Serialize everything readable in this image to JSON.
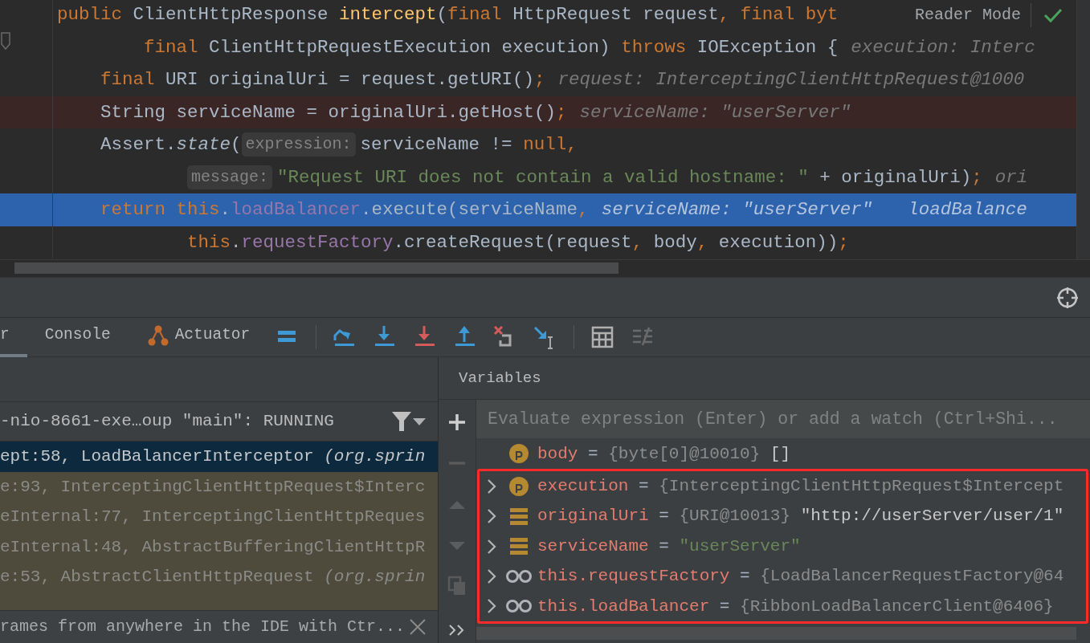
{
  "editor": {
    "reader_mode": "Reader Mode",
    "lines": [
      {
        "breakpoint": false,
        "current": false,
        "fold_marker": false,
        "segments": [
          {
            "kind": "code",
            "tokens": [
              {
                "kind": "kw",
                "text": "public "
              },
              {
                "kind": "plain",
                "text": "ClientHttpResponse "
              },
              {
                "kind": "method",
                "text": "intercept"
              },
              {
                "kind": "plain",
                "text": "("
              },
              {
                "kind": "kw",
                "text": "final "
              },
              {
                "kind": "plain",
                "text": "HttpRequest request"
              },
              {
                "kind": "kw",
                "text": ", final byt"
              }
            ]
          }
        ]
      },
      {
        "breakpoint": false,
        "current": false,
        "fold_marker": true,
        "segments": [
          {
            "kind": "code",
            "tokens": [
              {
                "kind": "kw",
                "text": "final "
              },
              {
                "kind": "plain",
                "text": "ClientHttpRequestExecution execution) "
              },
              {
                "kind": "kw",
                "text": "throws "
              },
              {
                "kind": "plain",
                "text": "IOException {"
              }
            ]
          },
          {
            "kind": "hint",
            "text": "execution: Interc"
          }
        ]
      },
      {
        "breakpoint": false,
        "current": false,
        "fold_marker": false,
        "segments": [
          {
            "kind": "code",
            "tokens": [
              {
                "kind": "kw",
                "text": "final "
              },
              {
                "kind": "plain",
                "text": "URI originalUri = request.getURI()"
              },
              {
                "kind": "kw",
                "text": ";"
              }
            ]
          },
          {
            "kind": "hint",
            "text": "request: InterceptingClientHttpRequest@1000"
          }
        ]
      },
      {
        "breakpoint": true,
        "current": false,
        "fold_marker": false,
        "segments": [
          {
            "kind": "code",
            "tokens": [
              {
                "kind": "plain",
                "text": "String serviceName = originalUri.getHost()"
              },
              {
                "kind": "kw",
                "text": ";"
              }
            ]
          },
          {
            "kind": "hint",
            "text": "serviceName: \"userServer\""
          }
        ]
      },
      {
        "breakpoint": false,
        "current": false,
        "fold_marker": false,
        "segments": [
          {
            "kind": "code",
            "tokens": [
              {
                "kind": "plain",
                "text": "Assert."
              },
              {
                "kind": "italic",
                "text": "state"
              },
              {
                "kind": "plain",
                "text": "("
              }
            ]
          },
          {
            "kind": "inlay",
            "text": "expression:"
          },
          {
            "kind": "code",
            "tokens": [
              {
                "kind": "plain",
                "text": "serviceName != "
              },
              {
                "kind": "kw",
                "text": "null,"
              }
            ]
          }
        ]
      },
      {
        "breakpoint": false,
        "current": false,
        "fold_marker": false,
        "segments": [
          {
            "kind": "inlay",
            "text": "message:"
          },
          {
            "kind": "code",
            "tokens": [
              {
                "kind": "str",
                "text": "\"Request URI does not contain a valid hostname: \""
              },
              {
                "kind": "plain",
                "text": " + originalUri)"
              },
              {
                "kind": "kw",
                "text": ";"
              }
            ]
          },
          {
            "kind": "hint",
            "text": "ori"
          }
        ]
      },
      {
        "breakpoint": false,
        "current": true,
        "fold_marker": false,
        "segments": [
          {
            "kind": "code",
            "tokens": [
              {
                "kind": "kw",
                "text": "return this"
              },
              {
                "kind": "plain",
                "text": "."
              },
              {
                "kind": "field",
                "text": "loadBalancer"
              },
              {
                "kind": "plain",
                "text": ".execute(serviceName"
              },
              {
                "kind": "kw",
                "text": ","
              }
            ]
          },
          {
            "kind": "hint",
            "text": "serviceName: \"userServer\""
          },
          {
            "kind": "hint",
            "text": "loadBalance"
          }
        ]
      },
      {
        "breakpoint": false,
        "current": false,
        "fold_marker": false,
        "segments": [
          {
            "kind": "code",
            "tokens": [
              {
                "kind": "kw",
                "text": "this"
              },
              {
                "kind": "plain",
                "text": "."
              },
              {
                "kind": "field",
                "text": "requestFactory"
              },
              {
                "kind": "plain",
                "text": ".createRequest(request"
              },
              {
                "kind": "kw",
                "text": ", "
              },
              {
                "kind": "plain",
                "text": "body"
              },
              {
                "kind": "kw",
                "text": ", "
              },
              {
                "kind": "plain",
                "text": "execution))"
              },
              {
                "kind": "kw",
                "text": ";"
              }
            ]
          }
        ]
      }
    ]
  },
  "debug_tabs": [
    {
      "label": "r",
      "selected": true,
      "has_icon": false
    },
    {
      "label": "Console",
      "selected": false,
      "has_icon": false
    },
    {
      "label": "Actuator",
      "selected": false,
      "has_icon": true
    }
  ],
  "thread_selector": "-nio-8661-exe…oup \"main\": RUNNING",
  "frames": [
    {
      "text": "ept:58, LoadBalancerInterceptor *(org.sprin*",
      "selected": true,
      "library": false
    },
    {
      "text": "e:93, InterceptingClientHttpRequest$Interc",
      "selected": false,
      "library": true
    },
    {
      "text": "eInternal:77, InterceptingClientHttpReques",
      "selected": false,
      "library": true
    },
    {
      "text": "eInternal:48, AbstractBufferingClientHttpR",
      "selected": false,
      "library": true
    },
    {
      "text": "e:53, AbstractClientHttpRequest *(org.sprin*",
      "selected": false,
      "library": true
    }
  ],
  "tip": "rames from anywhere in the IDE with Ctr...",
  "variables": {
    "title": "Variables",
    "placeholder": "Evaluate expression (Enter) or add a watch (Ctrl+Shi...",
    "items": [
      {
        "kind": "parameter",
        "name": "body",
        "separator": "=",
        "value": "{byte[0]@10010}",
        "extra": "[]",
        "is_string": false,
        "expandable": false,
        "outlined": false
      },
      {
        "kind": "parameter",
        "name": "execution",
        "separator": "=",
        "value": "{InterceptingClientHttpRequest$Intercept",
        "is_string": false,
        "expandable": true,
        "outlined": true
      },
      {
        "kind": "variable",
        "name": "originalUri",
        "separator": "=",
        "value": "{URI@10013}",
        "extra": "\"http://userServer/user/1\"",
        "is_string": false,
        "expandable": true,
        "outlined": true
      },
      {
        "kind": "variable",
        "name": "serviceName",
        "separator": "=",
        "value": "\"userServer\"",
        "is_string": true,
        "expandable": true,
        "outlined": true
      },
      {
        "kind": "watch",
        "name": "this.requestFactory",
        "separator": "=",
        "value": "{LoadBalancerRequestFactory@64",
        "is_string": false,
        "expandable": true,
        "outlined": true
      },
      {
        "kind": "watch",
        "name": "this.loadBalancer",
        "separator": "=",
        "value": "{RibbonLoadBalancerClient@6406}",
        "is_string": false,
        "expandable": true,
        "outlined": true
      }
    ]
  }
}
